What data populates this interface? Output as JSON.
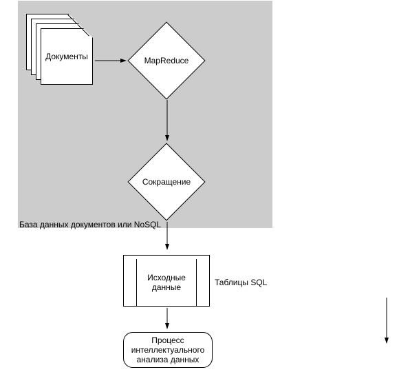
{
  "zone": {
    "label": "База данных документов или NoSQL"
  },
  "documents": {
    "label": "Документы"
  },
  "mapreduce": {
    "label": "MapReduce"
  },
  "reduce": {
    "label": "Сокращение"
  },
  "rawdata": {
    "label": "Исходные данные"
  },
  "sqltables": {
    "label": "Таблицы SQL"
  },
  "process": {
    "label": "Процесс интеллектуального анализа данных"
  }
}
